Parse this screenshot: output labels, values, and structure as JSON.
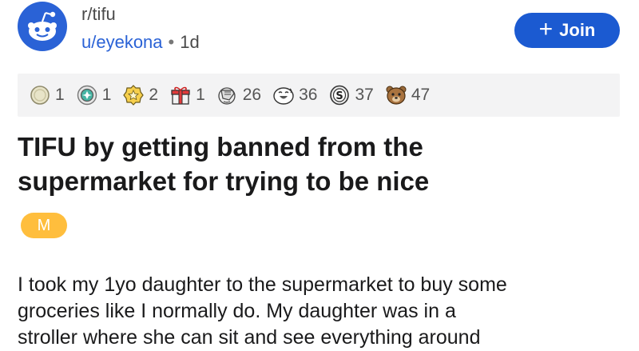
{
  "subreddit": {
    "name": "r/tifu"
  },
  "post": {
    "author": "u/eyekona",
    "separator": "•",
    "age": "1d",
    "title_line1": "TIFU by getting banned from the",
    "title_line2": "supermarket for trying to be nice",
    "flair": "M",
    "body_lines": [
      "I took my 1yo daughter to the supermarket to buy some",
      "groceries like I normally do. My daughter was in a",
      "stroller where she can sit and see everything around"
    ]
  },
  "join_button": {
    "icon": "+",
    "label": "Join"
  },
  "awards": [
    {
      "icon": "silver-coin-icon",
      "count": "1"
    },
    {
      "icon": "helpful-badge-icon",
      "count": "1"
    },
    {
      "icon": "star-badge-icon",
      "count": "2"
    },
    {
      "icon": "gift-icon",
      "count": "1"
    },
    {
      "icon": "facepalm-icon",
      "count": "26"
    },
    {
      "icon": "laughing-face-icon",
      "count": "36"
    },
    {
      "icon": "dollar-coin-icon",
      "count": "37"
    },
    {
      "icon": "bear-face-icon",
      "count": "47"
    }
  ],
  "colors": {
    "brand_blue": "#1b5ad1",
    "username_blue": "#2a62d6",
    "flair_orange": "#ffbe3d",
    "awards_bg": "#f3f3f4"
  }
}
